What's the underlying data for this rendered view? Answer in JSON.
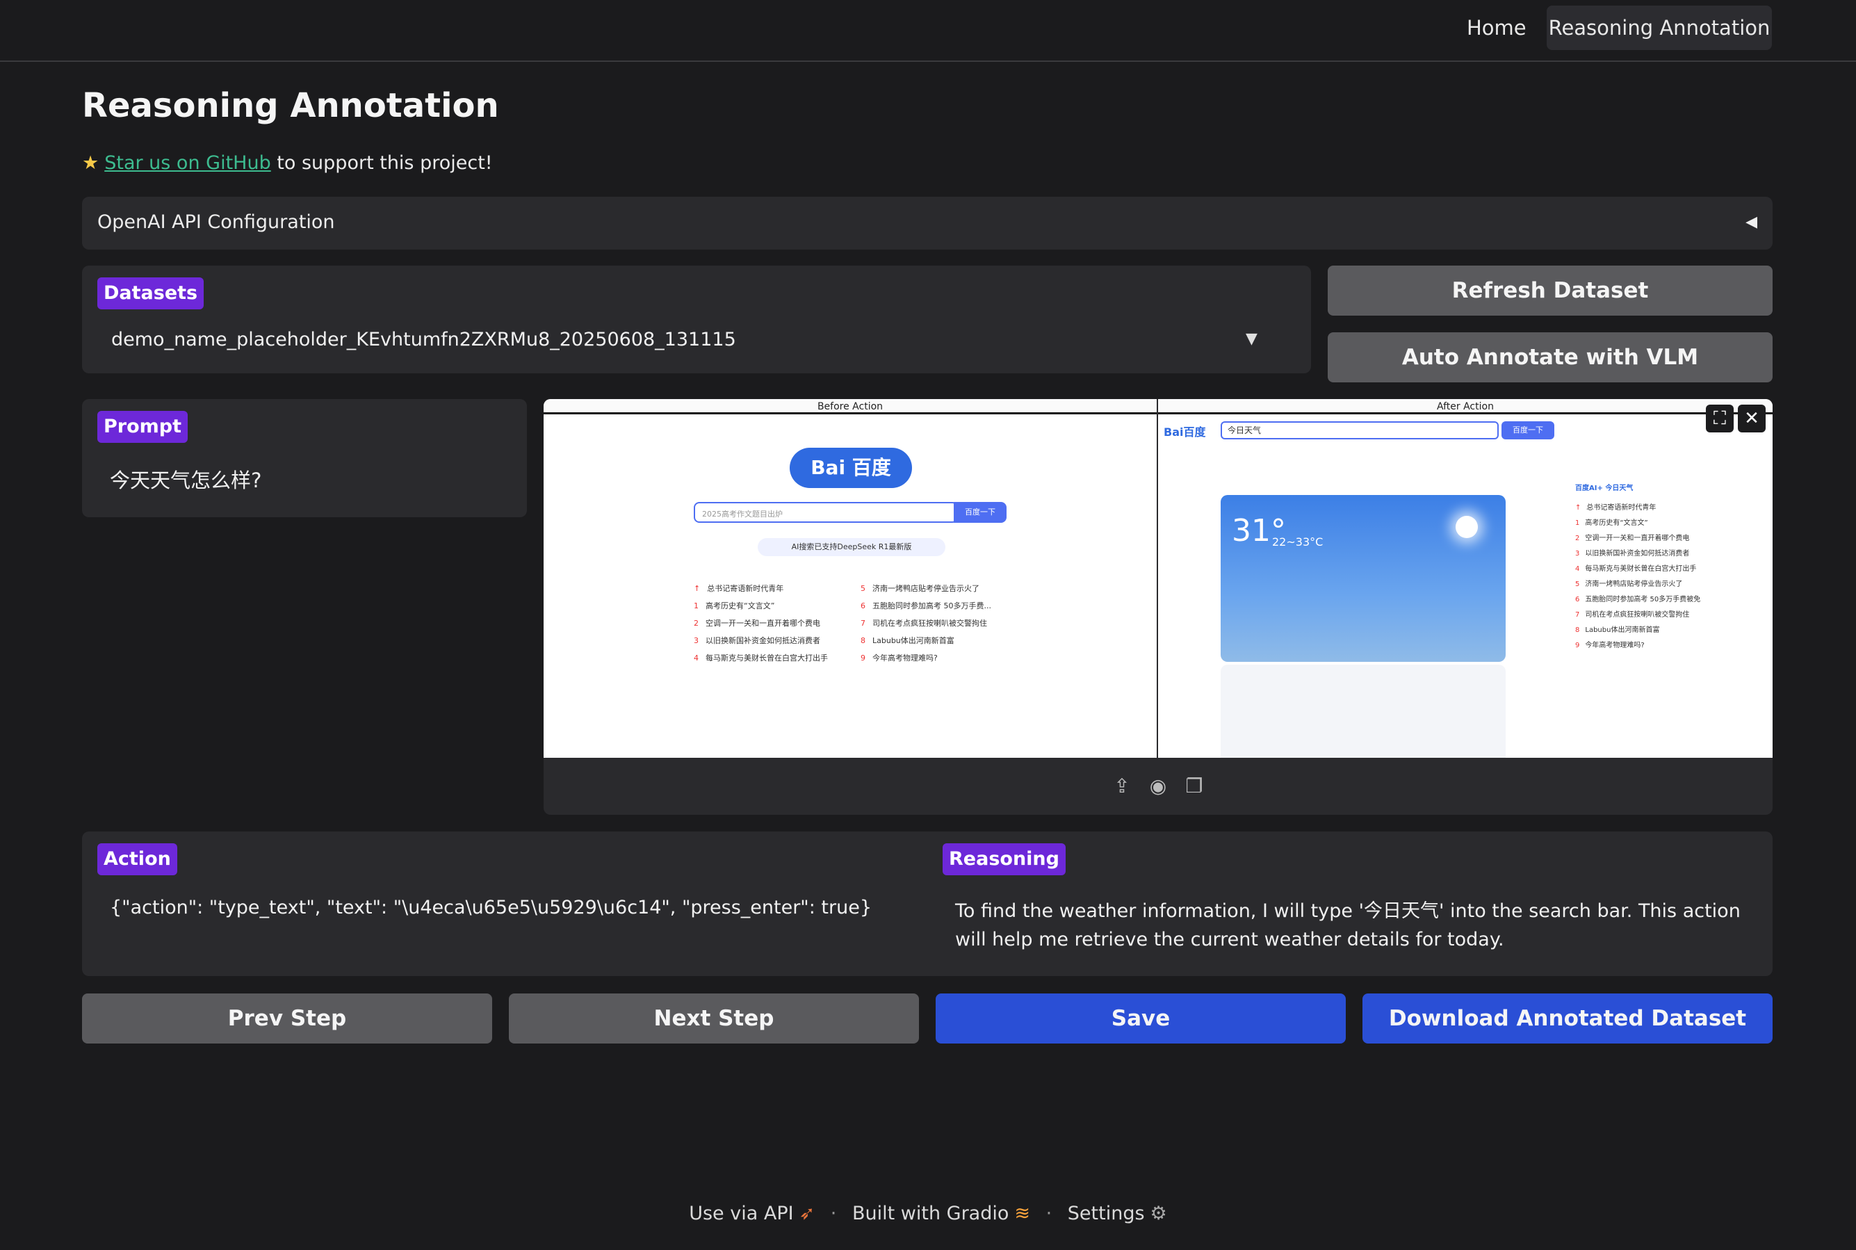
{
  "nav": {
    "home": "Home",
    "reasoning": "Reasoning Annotation"
  },
  "page": {
    "title": "Reasoning Annotation",
    "star_link": "Star us on GitHub",
    "star_suffix": " to support this project!"
  },
  "openai_config": {
    "label": "OpenAI API Configuration"
  },
  "datasets": {
    "label": "Datasets",
    "selected": "demo_name_placeholder_KEvhtumfn2ZXRMu8_20250608_131115"
  },
  "buttons": {
    "refresh": "Refresh Dataset",
    "auto_annotate": "Auto Annotate with VLM",
    "prev": "Prev Step",
    "next": "Next Step",
    "save": "Save",
    "download": "Download Annotated Dataset"
  },
  "prompt": {
    "label": "Prompt",
    "value": "今天天气怎么样?"
  },
  "image": {
    "before_caption": "Before Action",
    "after_caption": "After Action",
    "before": {
      "logo": "Bai 百度",
      "search_placeholder": "2025高考作文题目出炉",
      "search_button": "百度一下",
      "ai_pill": "AI搜索已支持DeepSeek R1最新版",
      "hot_left": [
        {
          "n": "↑",
          "t": "总书记寄语新时代青年"
        },
        {
          "n": "1",
          "t": "高考历史有“文言文”"
        },
        {
          "n": "2",
          "t": "空调一开一关和一直开着哪个费电"
        },
        {
          "n": "3",
          "t": "以旧换新国补资金如何抵达消费者"
        },
        {
          "n": "4",
          "t": "每马斯克与美财长曾在白宫大打出手"
        }
      ],
      "hot_right": [
        {
          "n": "5",
          "t": "济南一烤鸭店贴考停业告示火了"
        },
        {
          "n": "6",
          "t": "五胞胎同时参加高考 50多万手费..."
        },
        {
          "n": "7",
          "t": "司机在考点疯狂按喇叭被交警拘住"
        },
        {
          "n": "8",
          "t": "Labubu体出河南新首富"
        },
        {
          "n": "9",
          "t": "今年高考物理难吗?"
        }
      ]
    },
    "after": {
      "logo": "Bai百度",
      "search_text": "今日天气",
      "search_button": "百度一下",
      "temp": "31°",
      "range": "22~33°C",
      "side_title": "百度AI+ 今日天气",
      "side_list": [
        {
          "n": "↑",
          "t": "总书记寄语新时代青年"
        },
        {
          "n": "1",
          "t": "高考历史有“文言文”"
        },
        {
          "n": "2",
          "t": "空调一开一关和一直开着哪个费电"
        },
        {
          "n": "3",
          "t": "以旧换新国补资金如何抵达消费者"
        },
        {
          "n": "4",
          "t": "每马斯克与美财长曾在白宫大打出手"
        },
        {
          "n": "5",
          "t": "济南一烤鸭店贴考停业告示火了"
        },
        {
          "n": "6",
          "t": "五胞胎同时参加高考 50多万手费被免"
        },
        {
          "n": "7",
          "t": "司机在考点疯狂按喇叭被交警拘住"
        },
        {
          "n": "8",
          "t": "Labubu体出河南新首富"
        },
        {
          "n": "9",
          "t": "今年高考物理难吗?"
        }
      ]
    }
  },
  "action": {
    "label": "Action",
    "value": "{\"action\": \"type_text\", \"text\": \"\\u4eca\\u65e5\\u5929\\u6c14\", \"press_enter\": true}"
  },
  "reasoning": {
    "label": "Reasoning",
    "value": "To find the weather information, I will type '今日天气' into the search bar. This action will help me retrieve the current weather details for today."
  },
  "footer": {
    "api": "Use via API",
    "gradio": "Built with Gradio",
    "settings": "Settings"
  }
}
